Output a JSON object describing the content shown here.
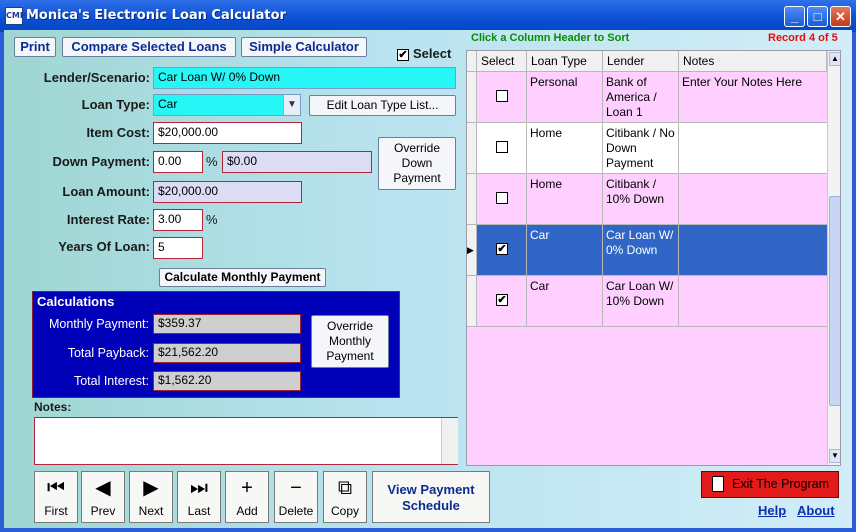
{
  "window": {
    "title": "Monica's Electronic Loan Calculator",
    "icon_text": "CMP",
    "minimize": "_",
    "maximize": "□",
    "close": "✕"
  },
  "toolbar": {
    "print": "Print",
    "compare": "Compare Selected Loans",
    "simple": "Simple Calculator",
    "select_label": "Select",
    "select_checked": "✔"
  },
  "form": {
    "lender_label": "Lender/Scenario:",
    "lender_value": "Car Loan W/ 0% Down",
    "loan_type_label": "Loan Type:",
    "loan_type_value": "Car",
    "edit_loan_type": "Edit Loan Type List...",
    "item_cost_label": "Item Cost:",
    "item_cost_value": "$20,000.00",
    "down_payment_label": "Down Payment:",
    "down_payment_pct": "0.00",
    "pct_sign": "%",
    "down_payment_amount": "$0.00",
    "override_down": "Override Down Payment",
    "loan_amount_label": "Loan Amount:",
    "loan_amount_value": "$20,000.00",
    "interest_label": "Interest Rate:",
    "interest_value": "3.00",
    "interest_pct": "%",
    "years_label": "Years Of Loan:",
    "years_value": "5",
    "calculate": "Calculate Monthly Payment"
  },
  "calculations": {
    "title": "Calculations",
    "monthly_label": "Monthly Payment:",
    "monthly_value": "$359.37",
    "payback_label": "Total Payback:",
    "payback_value": "$21,562.20",
    "interest_label": "Total Interest:",
    "interest_value": "$1,562.20",
    "override_monthly": "Override Monthly Payment"
  },
  "notes": {
    "label": "Notes:",
    "value": ""
  },
  "grid": {
    "hint": "Click a Column Header to Sort",
    "record": "Record 4 of 5",
    "headers": [
      "Select",
      "Loan Type",
      "Lender",
      "Notes"
    ],
    "rows": [
      {
        "checked": "",
        "loan_type": "Personal",
        "lender": "Bank of America / Loan 1",
        "notes": "Enter Your Notes Here",
        "bg": "#ffd0ff"
      },
      {
        "checked": "",
        "loan_type": "Home",
        "lender": "Citibank / No Down Payment",
        "notes": "",
        "bg": "#ffffff"
      },
      {
        "checked": "",
        "loan_type": "Home",
        "lender": "Citibank / 10% Down",
        "notes": "",
        "bg": "#ffd0ff"
      },
      {
        "checked": "✔",
        "loan_type": "Car",
        "lender": "Car Loan W/ 0% Down",
        "notes": "",
        "bg": "#3166c6"
      },
      {
        "checked": "✔",
        "loan_type": "Car",
        "lender": "Car Loan W/ 10% Down",
        "notes": "",
        "bg": "#ffd0ff"
      }
    ]
  },
  "nav": {
    "first": "First",
    "prev": "Prev",
    "next": "Next",
    "last": "Last",
    "add": "Add",
    "delete": "Delete",
    "copy": "Copy",
    "view_schedule": "View Payment Schedule"
  },
  "footer": {
    "exit": "Exit The Program",
    "help": "Help",
    "about": "About"
  }
}
